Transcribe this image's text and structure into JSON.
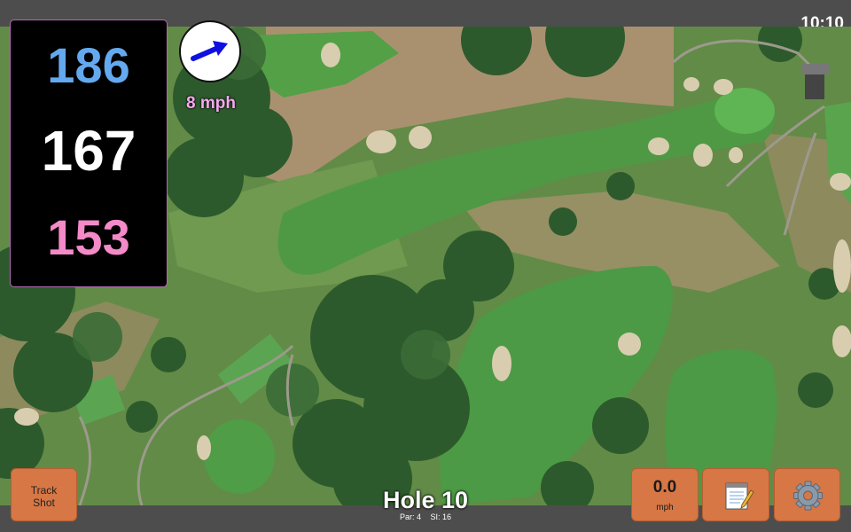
{
  "status_bar": {
    "time": "10:10"
  },
  "distances": {
    "back": "186",
    "middle": "167",
    "front": "153"
  },
  "wind": {
    "speed": "8 mph",
    "arrow_icon": "arrow-right-icon"
  },
  "buttons": {
    "track_shot": {
      "line1": "Track",
      "line2": "Shot"
    },
    "speed": {
      "value": "0.0",
      "unit": "mph"
    },
    "notes": {
      "icon": "notepad-icon"
    },
    "settings": {
      "icon": "gear-icon"
    }
  },
  "hole": {
    "title": "Hole 10",
    "par": "Par: 4",
    "stroke_index": "SI: 16"
  },
  "colors": {
    "back_distance": "#64a9ef",
    "middle_distance": "#ffffff",
    "front_distance": "#f48ac8",
    "button": "#d67745",
    "wind_arrow": "#1010e0"
  }
}
